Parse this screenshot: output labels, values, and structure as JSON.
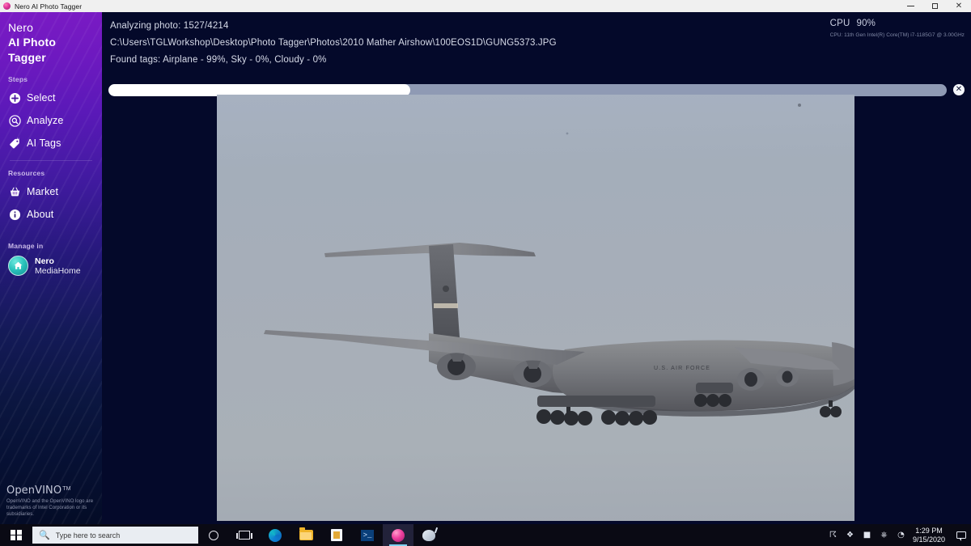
{
  "titlebar": {
    "title": "Nero AI Photo Tagger",
    "app_icon": "nero-app-icon",
    "minimize_label": "–",
    "maximize_label": "❐",
    "close_label": "✕"
  },
  "sidebar": {
    "brand_line1": "Nero",
    "brand_line2": "AI Photo",
    "brand_line3": "Tagger",
    "steps_label": "Steps",
    "steps": [
      {
        "label": "Select",
        "icon": "plus-circle-icon"
      },
      {
        "label": "Analyze",
        "icon": "magnifier-circle-icon"
      },
      {
        "label": "AI Tags",
        "icon": "ai-tag-icon"
      }
    ],
    "resources_label": "Resources",
    "resources": [
      {
        "label": "Market",
        "icon": "shopping-basket-icon"
      },
      {
        "label": "About",
        "icon": "info-circle-icon"
      }
    ],
    "manage_label": "Manage in",
    "manage_app_line1": "Nero",
    "manage_app_line2": "MediaHome",
    "manage_app_icon": "home-circle-icon",
    "openvino_name": "OpenVINO",
    "openvino_tm": "TM",
    "openvino_note": "OpenVINO and the OpenVINO logo are trademarks of Intel Corporation or its subsidiaries."
  },
  "status": {
    "line1": "Analyzing photo: 1527/4214",
    "line2": "C:\\Users\\TGLWorkshop\\Desktop\\Photo Tagger\\Photos\\2010 Mather Airshow\\100EOS1D\\GUNG5373.JPG",
    "line3": "Found tags: Airplane - 99%, Sky - 0%, Cloudy - 0%"
  },
  "cpu": {
    "label": "CPU",
    "percent": "90%",
    "detail": "CPU: 11th Gen Intel(R) Core(TM) i7-1185G7 @ 3.00GHz"
  },
  "progress": {
    "value_percent": 36,
    "fill_width_css": "36%",
    "cancel_icon": "close-circle-icon",
    "cancel_label": "✕"
  },
  "photo": {
    "alt": "Military cargo airplane (C-5 Galaxy) in flight with landing gear down against a pale blue-grey sky",
    "sky_top_color": "#a7b1c1",
    "sky_bottom_color": "#a3aab3",
    "aircraft_color": "#6e7078"
  },
  "taskbar": {
    "start_label": "start-button",
    "search_placeholder": "Type here to search",
    "search_icon": "search-icon",
    "items": [
      {
        "name": "cortana",
        "icon": "circle-icon"
      },
      {
        "name": "task-view",
        "icon": "task-view-icon"
      },
      {
        "name": "edge",
        "icon": "edge-icon"
      },
      {
        "name": "file-explorer",
        "icon": "folder-icon"
      },
      {
        "name": "microsoft-store",
        "icon": "store-icon"
      },
      {
        "name": "powershell",
        "icon": "powershell-icon"
      },
      {
        "name": "nero-ai-photo-tagger",
        "icon": "nero-app-icon",
        "active": true
      },
      {
        "name": "other-app",
        "icon": "app-icon"
      }
    ],
    "powershell_glyph": ">_",
    "tray_icons": [
      "bluetooth-icon",
      "security-icon",
      "battery-icon",
      "network-icon",
      "volume-icon"
    ],
    "tray_glyphs": [
      "☈",
      "❖",
      "■",
      "⎈",
      "◔"
    ],
    "time": "1:29 PM",
    "date": "9/15/2020",
    "notifications_icon": "notification-icon"
  },
  "colors": {
    "sidebar_top": "#7a1bc4",
    "sidebar_bottom": "#040c26",
    "content_bg": "#04092a",
    "progress_fill": "#ffffff",
    "progress_track": "#8f9ab4",
    "accent_teal": "#2cc4bd"
  }
}
